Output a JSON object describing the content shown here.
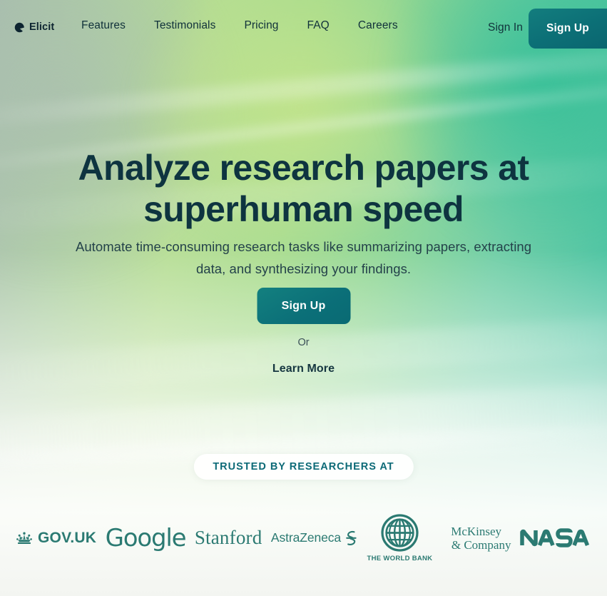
{
  "brand": {
    "name": "Elicit",
    "mark_icon": "elicit-crescent-icon"
  },
  "nav": {
    "links": [
      {
        "label": "Features"
      },
      {
        "label": "Testimonials"
      },
      {
        "label": "Pricing"
      },
      {
        "label": "FAQ"
      },
      {
        "label": "Careers"
      }
    ],
    "sign_in_label": "Sign In",
    "sign_up_label": "Sign Up"
  },
  "hero": {
    "headline": "Analyze research papers at superhuman speed",
    "subhead": "Automate time-consuming research tasks like summarizing papers, extracting data, and synthesizing your findings.",
    "primary_cta_label": "Sign Up",
    "or_label": "Or",
    "secondary_cta_label": "Learn More"
  },
  "social_proof": {
    "pill_label": "TRUSTED BY RESEARCHERS AT",
    "logos": [
      {
        "name": "GOV.UK",
        "text": "GOV.UK",
        "icon": "crown-icon"
      },
      {
        "name": "Google",
        "text": "Google"
      },
      {
        "name": "Stanford",
        "text": "Stanford"
      },
      {
        "name": "AstraZeneca",
        "text": "AstraZeneca",
        "icon": "astrazeneca-swirl-icon"
      },
      {
        "name": "The World Bank",
        "text": "THE WORLD BANK",
        "icon": "globe-icon"
      },
      {
        "name": "McKinsey & Company",
        "line1": "McKinsey",
        "line2": "& Company"
      },
      {
        "name": "NASA",
        "text": "NASA",
        "icon": "nasa-worm-icon"
      }
    ]
  },
  "colors": {
    "accent_teal": "#0c6f76",
    "headline": "#0e3440",
    "logo_teal": "#2b7a72",
    "pill_text": "#0d6a77"
  }
}
